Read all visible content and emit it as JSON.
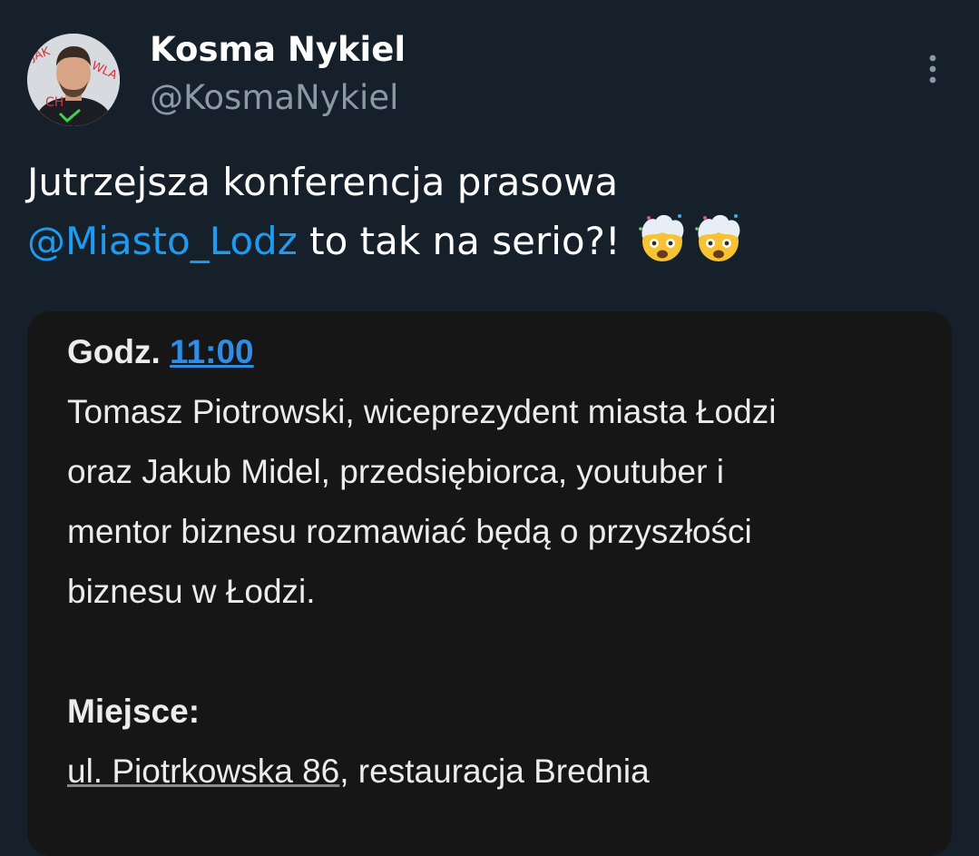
{
  "author": {
    "name": "Kosma Nykiel",
    "handle": "@KosmaNykiel"
  },
  "tweet": {
    "line1": "Jutrzejsza konferencja prasowa",
    "mention": "@Miasto_Lodz",
    "line2_rest": " to tak na serio?!",
    "emoji": "exploding-head"
  },
  "media": {
    "time_label": "Godz.",
    "time_value": "11:00",
    "description_lines": [
      "Tomasz Piotrowski, wiceprezydent miasta Łodzi",
      "oraz Jakub Midel, przedsiębiorca, youtuber i",
      "mentor biznesu rozmawiać będą o przyszłości",
      "biznesu w Łodzi."
    ],
    "place_label": "Miejsce:",
    "address_link": "ul. Piotrkowska 86",
    "address_rest": ", restauracja Brednia"
  },
  "colors": {
    "background": "#15202b",
    "link": "#1d9bf0",
    "handle": "#8b98a5",
    "media_background": "#161616"
  }
}
